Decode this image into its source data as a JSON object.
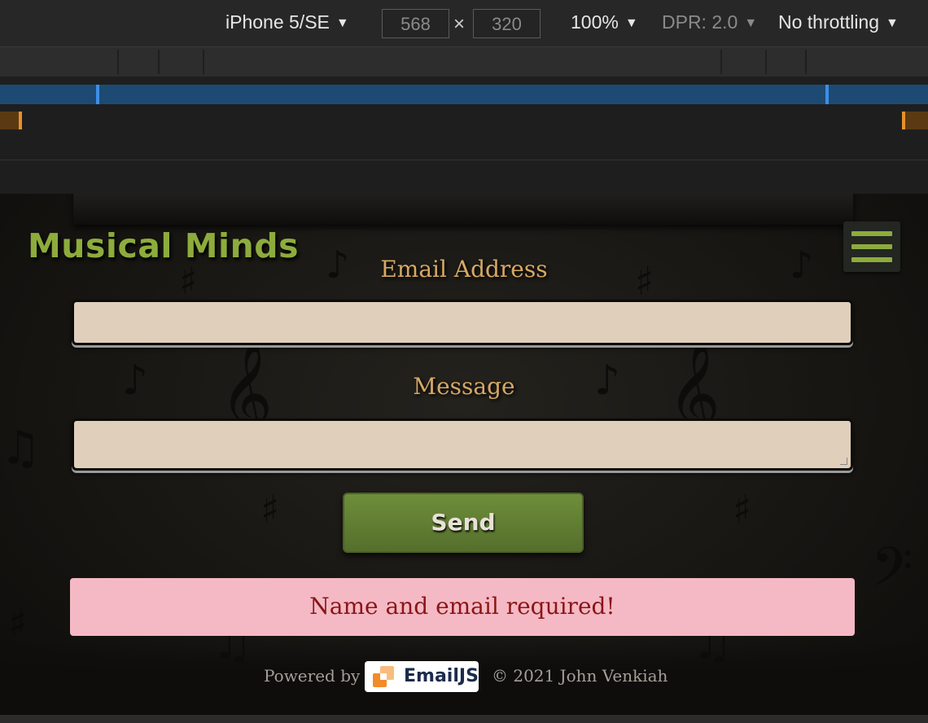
{
  "devtools": {
    "device": "iPhone 5/SE",
    "width": "568",
    "height": "320",
    "dimension_separator": "×",
    "zoom": "100%",
    "dpr": "DPR: 2.0",
    "throttling": "No throttling",
    "caret": "▼"
  },
  "site": {
    "brand": "Musical Minds",
    "email_label": "Email Address",
    "email_value": "",
    "message_label": "Message",
    "message_value": "",
    "send_label": "Send",
    "error_message": "Name and email required!",
    "footer": {
      "powered_by": "Powered by",
      "emailjs_badge": "EmailJS",
      "copyright": "© 2021 John Venkiah"
    },
    "colors": {
      "brand": "#8dac3c",
      "label": "#d6a866",
      "field_bg": "#e0cfbb",
      "button": "#62802f",
      "alert_bg": "#f4b9c4",
      "alert_text": "#8a1616"
    },
    "icons": [
      "hamburger-menu-icon",
      "emailjs-logo-icon"
    ]
  }
}
